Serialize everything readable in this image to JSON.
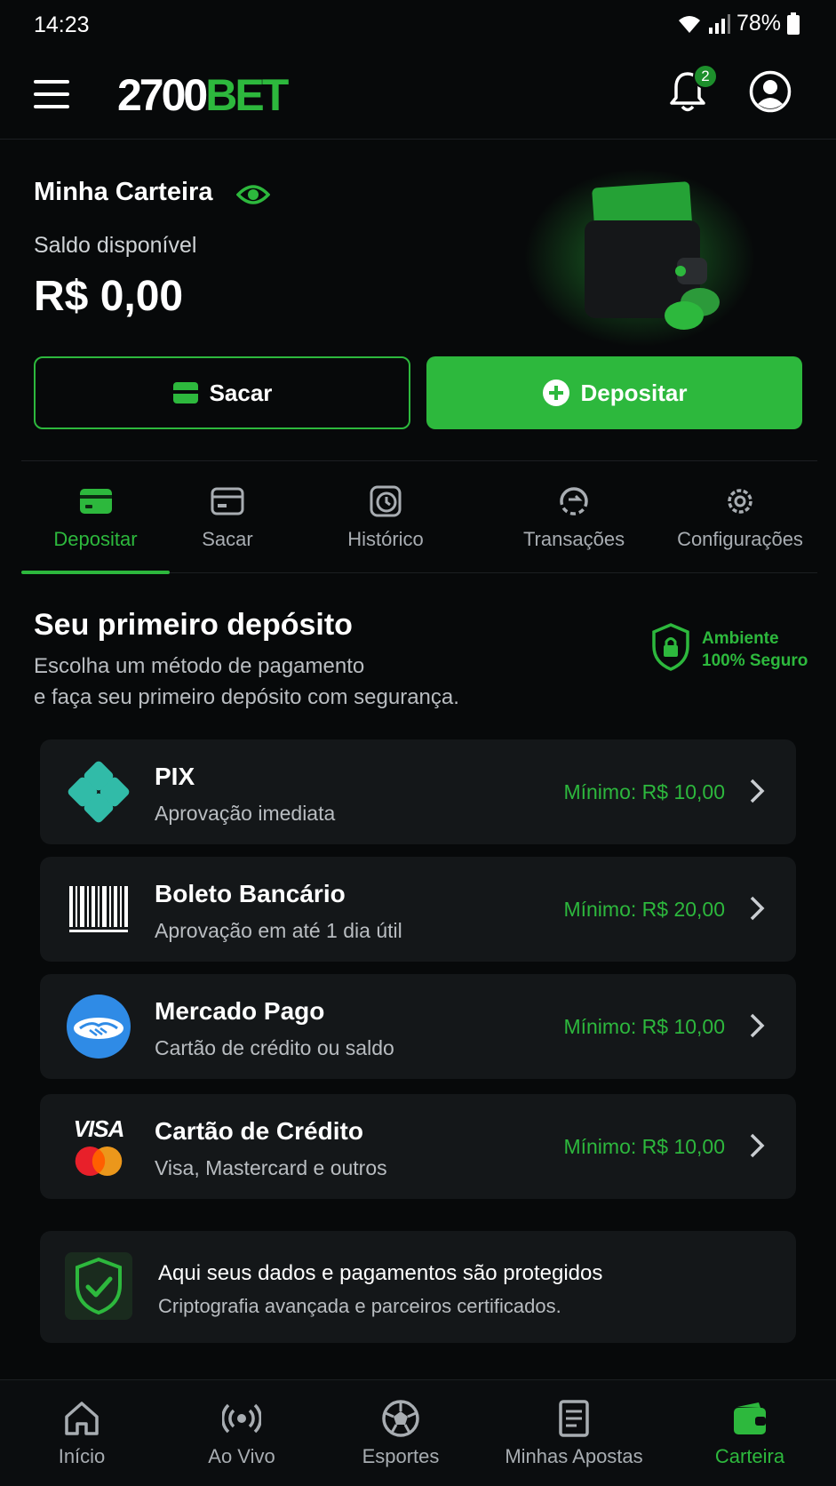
{
  "status_bar": {
    "time": "14:23",
    "battery": "78%"
  },
  "header": {
    "logo_white": "2700",
    "logo_green": "BET",
    "notification_count": "2"
  },
  "wallet": {
    "title": "Minha Carteira",
    "balance_label": "Saldo disponível",
    "balance_value": "R$ 0,00",
    "withdraw_label": "Sacar",
    "deposit_label": "Depositar"
  },
  "tabs": [
    {
      "label": "Depositar",
      "icon": "card-icon",
      "active": true
    },
    {
      "label": "Sacar",
      "icon": "withdraw-card-icon"
    },
    {
      "label": "Histórico",
      "icon": "history-icon"
    },
    {
      "label": "Transações",
      "icon": "transactions-icon"
    },
    {
      "label": "Configurações",
      "icon": "gear-icon"
    }
  ],
  "first_deposit": {
    "title": "Seu primeiro depósito",
    "subtitle_line1": "Escolha um método de pagamento",
    "subtitle_line2": "e faça seu primeiro depósito com segurança.",
    "secure_line1": "Ambiente",
    "secure_line2": "100% Seguro"
  },
  "payment_methods": [
    {
      "name": "PIX",
      "description": "Aprovação imediata",
      "minimum": "Mínimo: R$ 10,00",
      "icon": "pix-icon"
    },
    {
      "name": "Boleto Bancário",
      "description": "Aprovação em até 1 dia útil",
      "minimum": "Mínimo: R$ 20,00",
      "icon": "barcode-icon"
    },
    {
      "name": "Mercado Pago",
      "description": "Cartão de crédito ou saldo",
      "minimum": "Mínimo: R$ 10,00",
      "icon": "mercado-pago-icon"
    },
    {
      "name": "Cartão de Crédito",
      "description": "Visa, Mastercard e outros",
      "minimum": "Mínimo: R$ 10,00",
      "icon": "visa-mastercard-icon",
      "visa_text": "VISA"
    }
  ],
  "protection": {
    "title": "Aqui seus dados e pagamentos são protegidos",
    "subtitle": "Criptografia avançada e parceiros certificados."
  },
  "bottom_nav": [
    {
      "label": "Início",
      "icon": "home-icon"
    },
    {
      "label": "Ao Vivo",
      "icon": "live-icon"
    },
    {
      "label": "Esportes",
      "icon": "soccer-ball-icon"
    },
    {
      "label": "Minhas Apostas",
      "icon": "bet-slip-icon"
    },
    {
      "label": "Carteira",
      "icon": "wallet-icon",
      "active": true
    }
  ],
  "colors": {
    "accent": "#2db83d",
    "background": "#07090a",
    "card": "#141719"
  }
}
